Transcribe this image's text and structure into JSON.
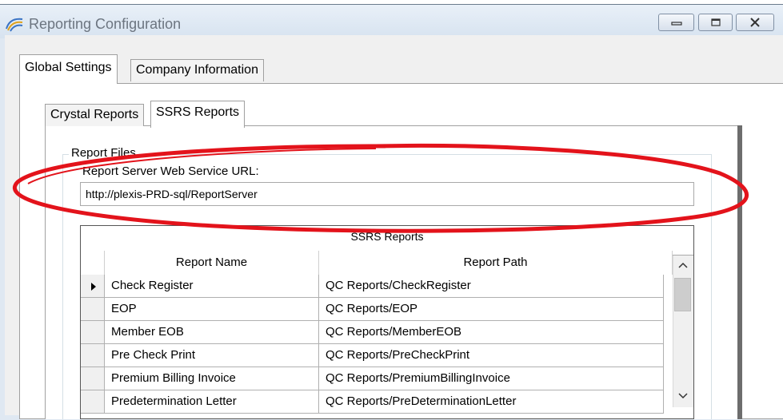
{
  "window": {
    "title": "Reporting Configuration"
  },
  "tabs": {
    "outer": [
      {
        "label": "Global Settings",
        "selected": true
      },
      {
        "label": "Company Information",
        "selected": false
      }
    ],
    "inner": [
      {
        "label": "Crystal Reports",
        "selected": false
      },
      {
        "label": "SSRS Reports",
        "selected": true
      }
    ]
  },
  "report_files": {
    "group_label": "Report Files",
    "url_label": "Report Server Web Service URL:",
    "url_value": "http://plexis-PRD-sql/ReportServer"
  },
  "grid": {
    "caption": "SSRS Reports",
    "columns": [
      "Report Name",
      "Report Path"
    ],
    "rows": [
      {
        "name": "Check Register",
        "path": "QC Reports/CheckRegister",
        "current": true
      },
      {
        "name": "EOP",
        "path": "QC Reports/EOP",
        "current": false
      },
      {
        "name": "Member EOB",
        "path": "QC Reports/MemberEOB",
        "current": false
      },
      {
        "name": "Pre Check Print",
        "path": "QC Reports/PreCheckPrint",
        "current": false
      },
      {
        "name": "Premium Billing Invoice",
        "path": "QC Reports/PremiumBillingInvoice",
        "current": false
      },
      {
        "name": "Predetermination Letter",
        "path": "QC Reports/PreDeterminationLetter",
        "current": false
      }
    ]
  },
  "colors": {
    "annotation": "#e3131b",
    "titlebar": "#dfe8f2"
  },
  "icons": {
    "app": "app-logo-icon",
    "minimize": "minimize-icon",
    "maximize": "maximize-icon",
    "close": "close-icon",
    "row_pointer": "row-pointer-icon",
    "scroll_up": "chevron-up-icon",
    "scroll_down": "chevron-down-icon"
  }
}
